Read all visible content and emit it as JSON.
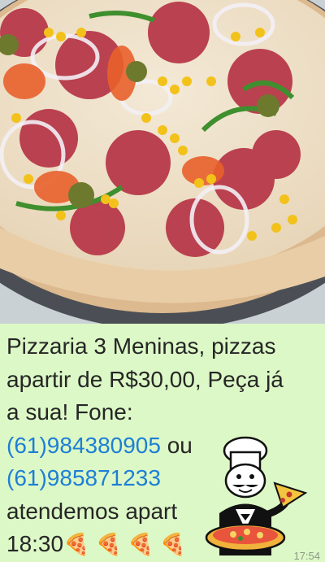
{
  "photo": {
    "alt_icon": "pizza-photo"
  },
  "message": {
    "line1": "Pizzaria 3 Meninas, pizzas",
    "line2": "apartir de R$30,00, Peça já",
    "line3": "a sua! Fone:",
    "phone1": "(61)984380905",
    "line4_suffix": " ou",
    "phone2": "(61)985871233",
    "line5": "atendemos apart",
    "line6": "18:30",
    "emoji": "🍕 🍕 🍕 🍕"
  },
  "timestamp": "17:54",
  "colors": {
    "bubble": "#dcf8c6",
    "link": "#1d7fd6",
    "text": "#262626"
  },
  "sticker": {
    "icon": "chef-with-pizza-sticker"
  }
}
